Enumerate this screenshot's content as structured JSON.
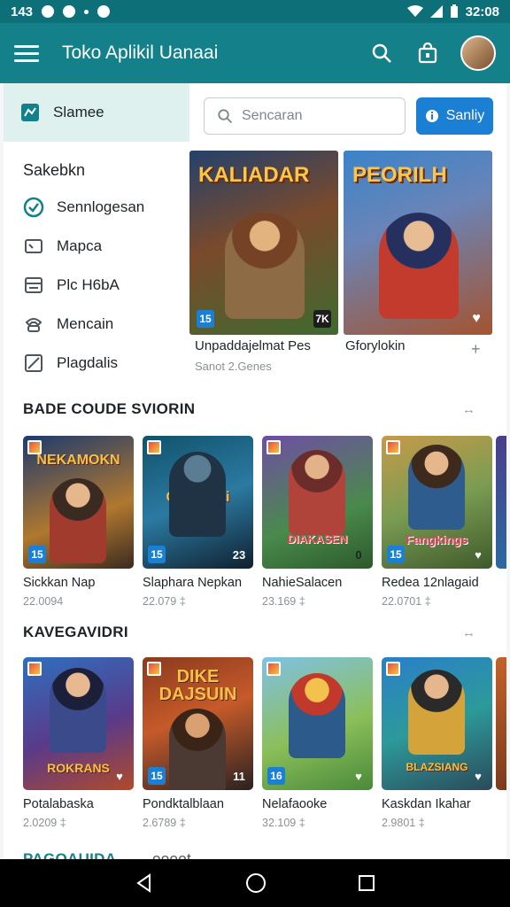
{
  "status_bar": {
    "time": "143",
    "clock": "32:08"
  },
  "app_bar": {
    "title": "Toko Aplikil Uanaai"
  },
  "sidebar": {
    "active_label": "Slamee",
    "heading": "Sakebkn",
    "items": [
      {
        "label": "Sennlogesan",
        "icon": "check-circle-icon"
      },
      {
        "label": "Mapca",
        "icon": "card-icon"
      },
      {
        "label": "Plc H6bA",
        "icon": "window-icon"
      },
      {
        "label": "Mencain",
        "icon": "phone-icon"
      },
      {
        "label": "Plagdalis",
        "icon": "flag-box-icon"
      }
    ]
  },
  "search": {
    "placeholder": "Sencaran",
    "button_label": "Sanliy"
  },
  "featured": [
    {
      "logo": "KALIADAR",
      "title": "Unpaddajelmat Pes",
      "subtitle": "Sanot 2.Genes",
      "badge": "15",
      "corner": "7K"
    },
    {
      "logo": "PEORILH",
      "title": "Gforylokin"
    }
  ],
  "sections": [
    {
      "title": "BADE COUDE SVIORIN",
      "arrow": "↔",
      "games": [
        {
          "name": "Sickkan Nap",
          "size": "22.0094",
          "logo": "NEKAMOKN",
          "badge": "15",
          "corner": ""
        },
        {
          "name": "Slaphara Nepkan",
          "size": "22.079 ‡",
          "logo": "Consimai",
          "badge": "15",
          "corner": "23"
        },
        {
          "name": "NahieSalacen",
          "size": "23.169 ‡",
          "logo": "DIAKASEN",
          "badge": "",
          "corner": "0"
        },
        {
          "name": "Redea 12nlagaid",
          "size": "22.0701 ‡",
          "logo": "Fangkings",
          "badge": "15",
          "corner": "♥"
        }
      ]
    },
    {
      "title": "KAVEGAVIDRI",
      "arrow": "↔",
      "games": [
        {
          "name": "Potalabaska",
          "size": "2.0209 ‡",
          "logo": "ROKRANS",
          "badge": "",
          "corner": "♥"
        },
        {
          "name": "Pondktalblaan",
          "size": "2.6789 ‡",
          "logo": "DIKE DAJSUIN",
          "badge": "15",
          "corner": "11"
        },
        {
          "name": "Nelafaooke",
          "size": "32.109 ‡",
          "logo": "",
          "badge": "16",
          "corner": "♥"
        },
        {
          "name": "Kaskdan Ikahar",
          "size": "2.9801 ‡",
          "logo": "BLAZSIANG",
          "badge": "",
          "corner": "♥"
        }
      ]
    }
  ],
  "bottom_section": {
    "title": "PAGOAUIDA",
    "extra": "oooot"
  },
  "colors": {
    "app_bar": "#13808a",
    "status_bar": "#0d6f78",
    "accent": "#1b7fd4",
    "sidebar_active": "#dff1ee"
  }
}
